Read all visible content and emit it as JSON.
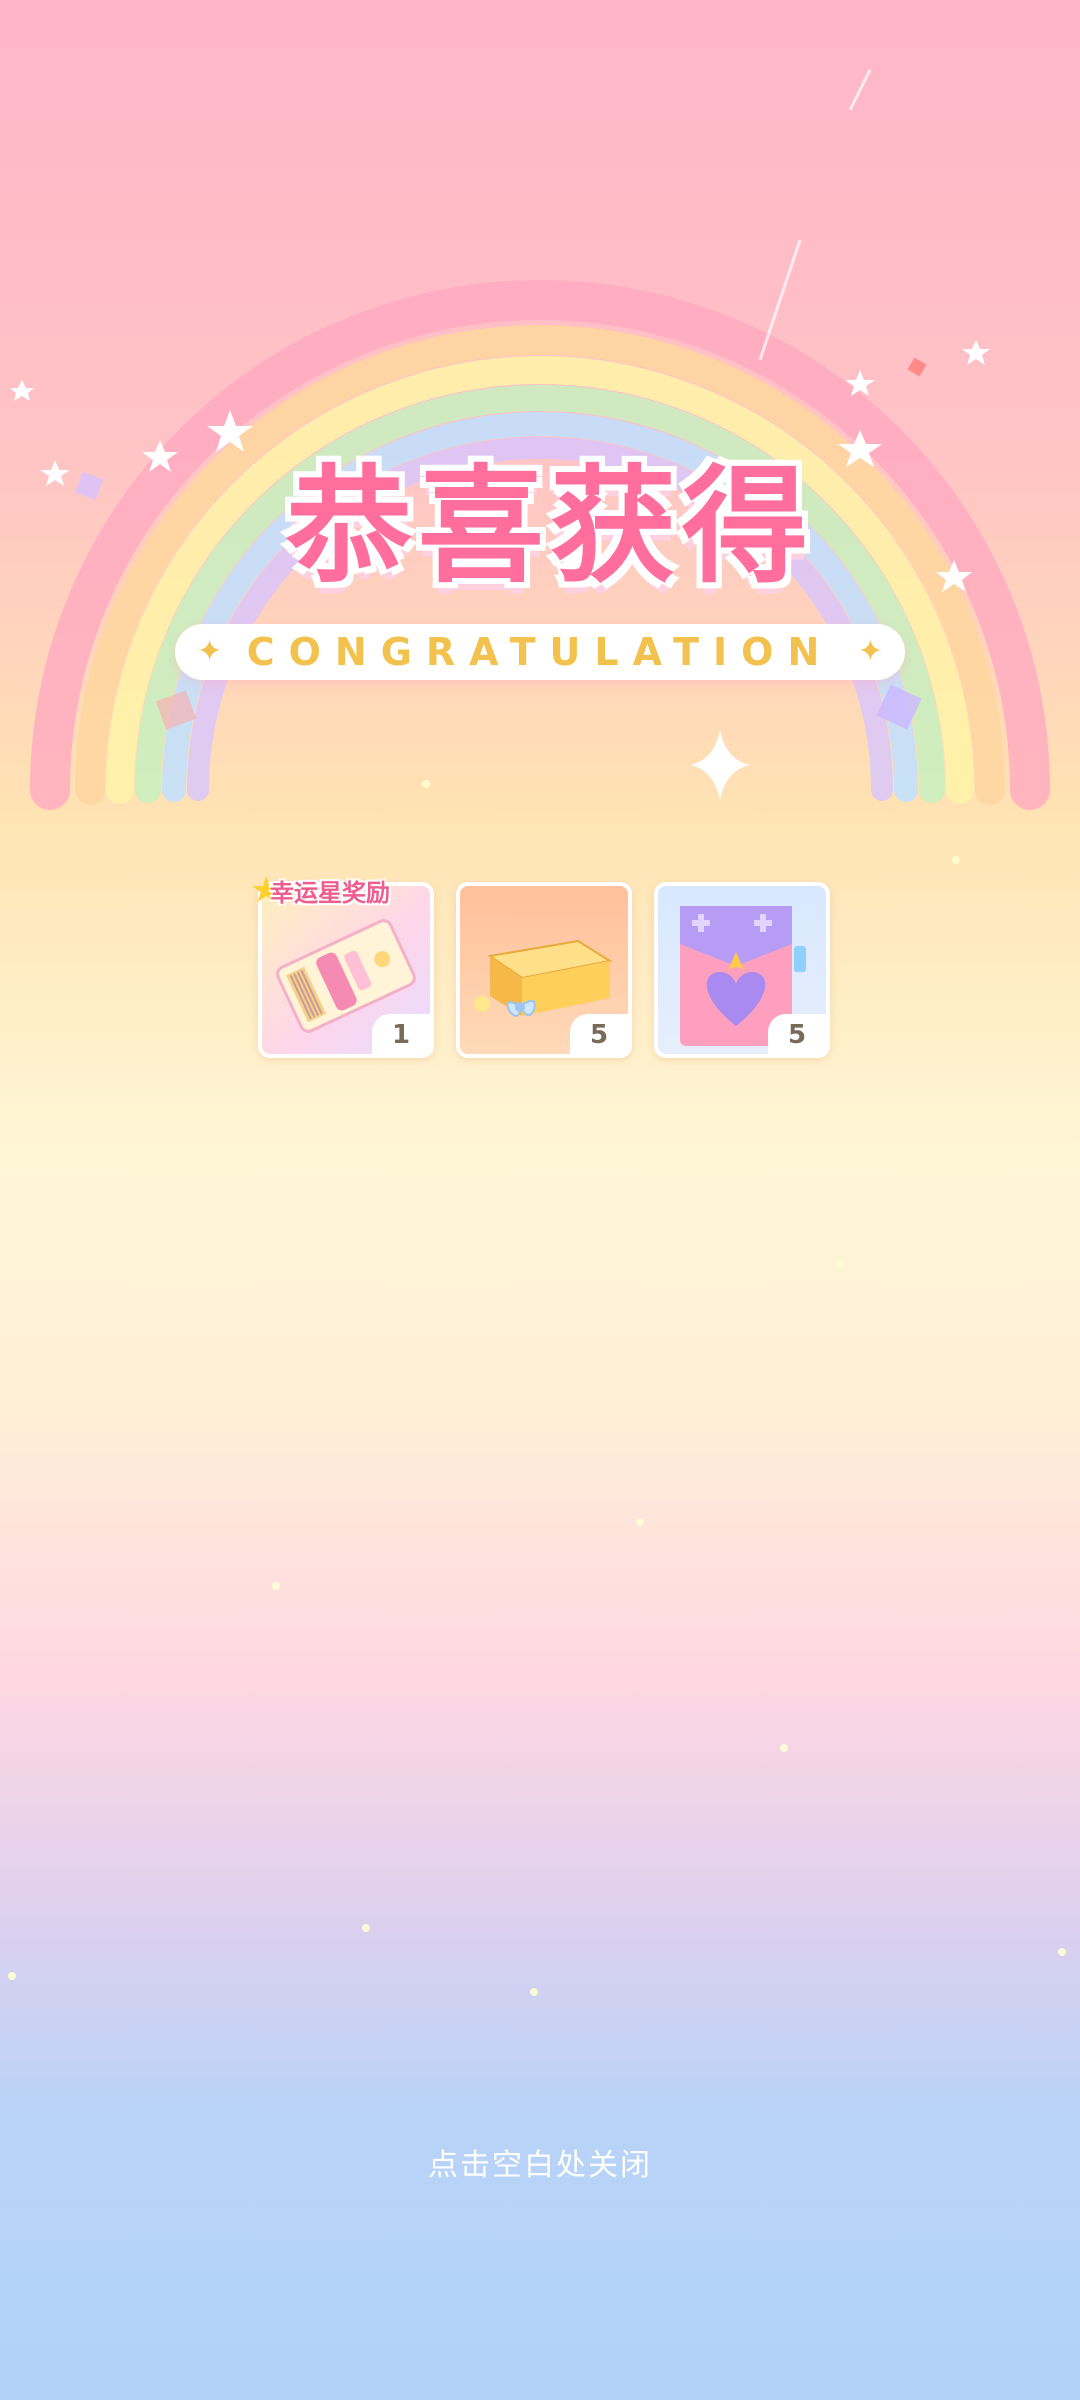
{
  "title": {
    "main": "恭喜获得",
    "subtitle": "CONGRATULATION"
  },
  "rewards": {
    "lucky_label": "幸运星奖励",
    "items": [
      {
        "name": "ticket",
        "icon": "ticket-icon",
        "qty": "1"
      },
      {
        "name": "gift-box",
        "icon": "gift-box-icon",
        "qty": "5"
      },
      {
        "name": "heart-bag",
        "icon": "heart-bag-icon",
        "qty": "5"
      }
    ]
  },
  "footer": {
    "close_hint": "点击空白处关闭"
  },
  "colors": {
    "title_pink": "#ff6e9c",
    "subtitle_gold": "#f2c14e",
    "lucky_pink": "#ef5d8f"
  }
}
